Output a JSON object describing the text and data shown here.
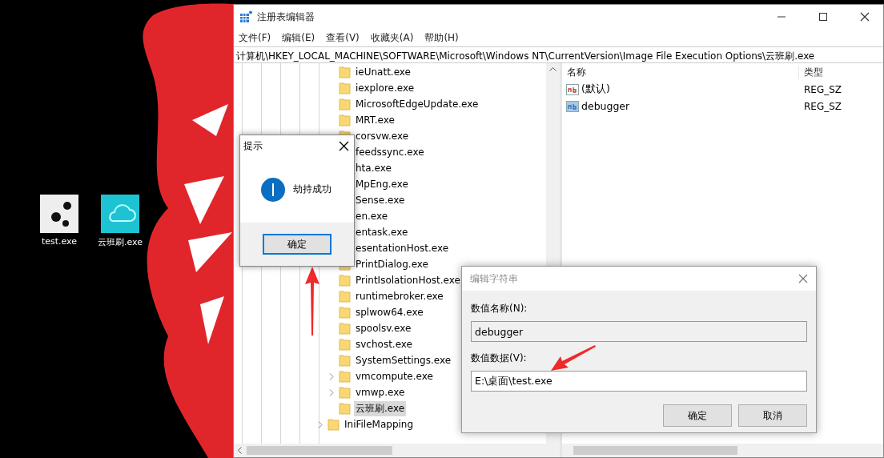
{
  "desktop": {
    "icons": [
      {
        "label": "test.exe",
        "kind": "image"
      },
      {
        "label": "云班刷.exe",
        "kind": "cloud"
      }
    ]
  },
  "registry_editor": {
    "title": "注册表编辑器",
    "menu": [
      "文件(F)",
      "编辑(E)",
      "查看(V)",
      "收藏夹(A)",
      "帮助(H)"
    ],
    "address": "计算机\\HKEY_LOCAL_MACHINE\\SOFTWARE\\Microsoft\\Windows NT\\CurrentVersion\\Image File Execution Options\\云班刷.exe",
    "tree": {
      "nodes": [
        {
          "label": "ieUnatt.exe",
          "expandable": false,
          "selected": false
        },
        {
          "label": "iexplore.exe",
          "expandable": false,
          "selected": false
        },
        {
          "label": "MicrosoftEdgeUpdate.exe",
          "expandable": false,
          "selected": false
        },
        {
          "label": "MRT.exe",
          "expandable": false,
          "selected": false
        },
        {
          "label": "corsvw.exe",
          "expandable": false,
          "selected": false
        },
        {
          "label": "feedssync.exe",
          "expandable": false,
          "selected": false
        },
        {
          "label": "hta.exe",
          "expandable": false,
          "selected": false
        },
        {
          "label": "MpEng.exe",
          "expandable": false,
          "selected": false
        },
        {
          "label": "Sense.exe",
          "expandable": false,
          "selected": false
        },
        {
          "label": "en.exe",
          "expandable": false,
          "selected": false
        },
        {
          "label": "entask.exe",
          "expandable": false,
          "selected": false
        },
        {
          "label": "esentationHost.exe",
          "expandable": false,
          "selected": false
        },
        {
          "label": "PrintDialog.exe",
          "expandable": false,
          "selected": false
        },
        {
          "label": "PrintIsolationHost.exe",
          "expandable": false,
          "selected": false
        },
        {
          "label": "runtimebroker.exe",
          "expandable": false,
          "selected": false
        },
        {
          "label": "splwow64.exe",
          "expandable": false,
          "selected": false
        },
        {
          "label": "spoolsv.exe",
          "expandable": false,
          "selected": false
        },
        {
          "label": "svchost.exe",
          "expandable": false,
          "selected": false
        },
        {
          "label": "SystemSettings.exe",
          "expandable": false,
          "selected": false
        },
        {
          "label": "vmcompute.exe",
          "expandable": true,
          "selected": false
        },
        {
          "label": "vmwp.exe",
          "expandable": true,
          "selected": false
        },
        {
          "label": "云班刷.exe",
          "expandable": false,
          "selected": true
        }
      ],
      "parent_level_nodes": [
        {
          "label": "IniFileMapping",
          "expandable": true,
          "selected": false
        }
      ]
    },
    "values": {
      "columns": [
        "名称",
        "类型"
      ],
      "rows": [
        {
          "name": "(默认)",
          "type": "REG_SZ",
          "kind": "default"
        },
        {
          "name": "debugger",
          "type": "REG_SZ",
          "kind": "value"
        }
      ]
    }
  },
  "message_box": {
    "title": "提示",
    "message": "劫持成功",
    "button": {
      "label": "确定",
      "focused": true
    }
  },
  "edit_string_dialog": {
    "title": "编辑字符串",
    "name_label": "数值名称(N):",
    "name_value": "debugger",
    "data_label": "数值数据(V):",
    "data_value": "E:\\桌面\\test.exe",
    "buttons": [
      "确定",
      "取消"
    ]
  }
}
